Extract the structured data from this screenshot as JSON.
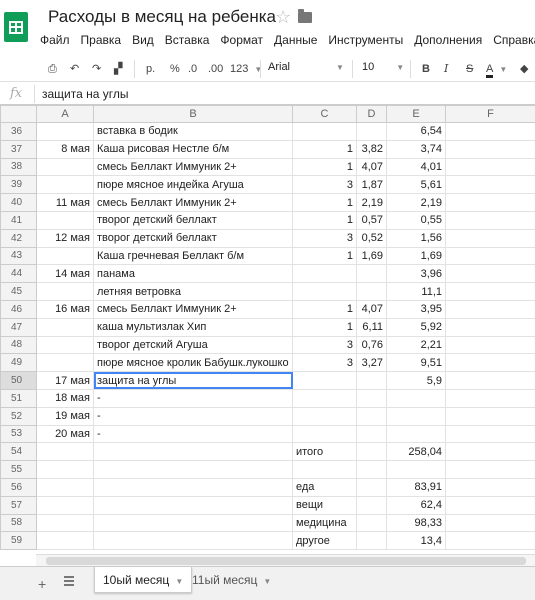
{
  "app": {
    "title": "Расходы в месяц на ребенка",
    "accent": "#0f9d58"
  },
  "menu": [
    "Файл",
    "Правка",
    "Вид",
    "Вставка",
    "Формат",
    "Данные",
    "Инструменты",
    "Дополнения",
    "Справка"
  ],
  "toolbar": {
    "currency": "р.",
    "percent": "%",
    "dec_less": ".0",
    "dec_more": ".00",
    "format_123": "123",
    "font": "Arial",
    "font_size": "10",
    "bold": "B",
    "italic": "I",
    "strike": "S",
    "text_color": "A"
  },
  "formula_bar": {
    "fx": "fx",
    "value": "защита на углы"
  },
  "columns": [
    "A",
    "B",
    "C",
    "D",
    "E",
    "F"
  ],
  "rows": [
    {
      "n": "36",
      "a": "",
      "b": "вставка в бодик",
      "c": "",
      "d": "",
      "e": "6,54"
    },
    {
      "n": "37",
      "a": "8 мая",
      "b": "Каша рисовая Нестле б/м",
      "c": "1",
      "d": "3,82",
      "e": "3,74"
    },
    {
      "n": "38",
      "a": "",
      "b": "смесь Беллакт Иммуник 2+",
      "c": "1",
      "d": "4,07",
      "e": "4,01"
    },
    {
      "n": "39",
      "a": "",
      "b": "пюре мясное индейка Агуша",
      "c": "3",
      "d": "1,87",
      "e": "5,61"
    },
    {
      "n": "40",
      "a": "11 мая",
      "b": "смесь Беллакт Иммуник 2+",
      "c": "1",
      "d": "2,19",
      "e": "2,19"
    },
    {
      "n": "41",
      "a": "",
      "b": "творог детский беллакт",
      "c": "1",
      "d": "0,57",
      "e": "0,55"
    },
    {
      "n": "42",
      "a": "12 мая",
      "b": "творог детский беллакт",
      "c": "3",
      "d": "0,52",
      "e": "1,56"
    },
    {
      "n": "43",
      "a": "",
      "b": "Каша гречневая Беллакт б/м",
      "c": "1",
      "d": "1,69",
      "e": "1,69"
    },
    {
      "n": "44",
      "a": "14 мая",
      "b": "панама",
      "c": "",
      "d": "",
      "e": "3,96"
    },
    {
      "n": "45",
      "a": "",
      "b": "летняя ветровка",
      "c": "",
      "d": "",
      "e": "11,1"
    },
    {
      "n": "46",
      "a": "16 мая",
      "b": "смесь Беллакт Иммуник 2+",
      "c": "1",
      "d": "4,07",
      "e": "3,95"
    },
    {
      "n": "47",
      "a": "",
      "b": "каша мультизлак Хип",
      "c": "1",
      "d": "6,11",
      "e": "5,92"
    },
    {
      "n": "48",
      "a": "",
      "b": "творог детский Агуша",
      "c": "3",
      "d": "0,76",
      "e": "2,21"
    },
    {
      "n": "49",
      "a": "",
      "b": "пюре мясное кролик Бабушк.лукошко",
      "c": "3",
      "d": "3,27",
      "e": "9,51"
    },
    {
      "n": "50",
      "a": "17 мая",
      "b": "защита на углы",
      "c": "",
      "d": "",
      "e": "5,9"
    },
    {
      "n": "51",
      "a": "18 мая",
      "b": "-",
      "c": "",
      "d": "",
      "e": ""
    },
    {
      "n": "52",
      "a": "19 мая",
      "b": "-",
      "c": "",
      "d": "",
      "e": ""
    },
    {
      "n": "53",
      "a": "20 мая",
      "b": "-",
      "c": "",
      "d": "",
      "e": ""
    },
    {
      "n": "54",
      "a": "",
      "b": "",
      "c": "итого",
      "d": "",
      "e": "258,04"
    },
    {
      "n": "55",
      "a": "",
      "b": "",
      "c": "",
      "d": "",
      "e": ""
    },
    {
      "n": "56",
      "a": "",
      "b": "",
      "c": "еда",
      "d": "",
      "e": "83,91"
    },
    {
      "n": "57",
      "a": "",
      "b": "",
      "c": "вещи",
      "d": "",
      "e": "62,4"
    },
    {
      "n": "58",
      "a": "",
      "b": "",
      "c": "медицина",
      "d": "",
      "e": "98,33"
    },
    {
      "n": "59",
      "a": "",
      "b": "",
      "c": "другое",
      "d": "",
      "e": "13,4"
    }
  ],
  "sheets": [
    {
      "label": "10ый месяц",
      "active": true
    },
    {
      "label": "11ый месяц",
      "active": false
    }
  ]
}
